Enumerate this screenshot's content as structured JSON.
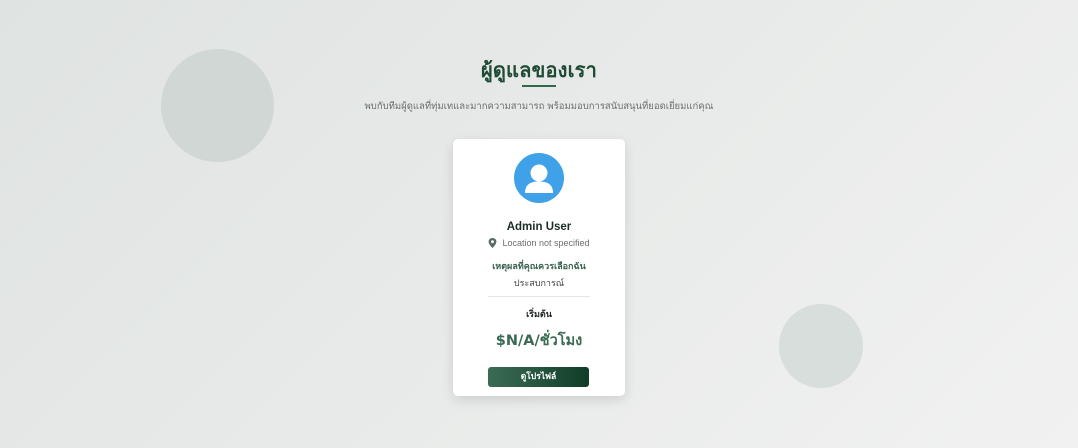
{
  "section": {
    "title": "ผู้ดูแลของเรา",
    "subtitle": "พบกับทีมผู้ดูแลที่ทุ่มเทและมากความสามารถ พร้อมมอบการสนับสนุนที่ยอดเยี่ยมแก่คุณ"
  },
  "caregivers": [
    {
      "avatar_icon": "user-avatar-icon",
      "name": "Admin User",
      "location_icon": "map-pin-icon",
      "location": "Location not specified",
      "why_label": "เหตุผลที่คุณควรเลือกฉัน",
      "why_value": "ประสบการณ์",
      "price_label": "เริ่มต้น",
      "price": "$N/A/ชั่วโมง",
      "profile_button": "ดูโปรไฟล์"
    }
  ],
  "colors": {
    "accent": "#1f4a34",
    "avatar_bg": "#3fa2e8",
    "price": "#3b6a52",
    "button_start": "#3c6b55",
    "button_end": "#0f3d28"
  }
}
